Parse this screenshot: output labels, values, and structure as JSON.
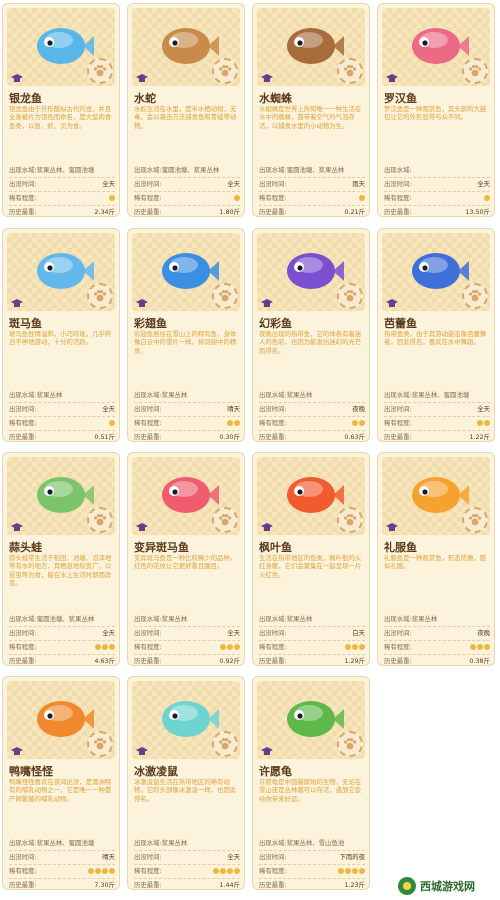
{
  "row_labels": {
    "water": "出现水域:",
    "time": "出没时间:",
    "rarity": "稀有程度:",
    "history": "历史最重:"
  },
  "watermark": {
    "text": "西城游戏网"
  },
  "cards": [
    {
      "id": "silver-arowana",
      "name": "银龙鱼",
      "desc": "银龙鱼由于外形酷似古代的龙，并且全身被片为银色而命名，是大型肉食鱼类，以鱼、虾、贝为食。",
      "water": "出现水域:浆果丛林、蜜圆池塘",
      "time": "全天",
      "rarity": 1,
      "history": "2.34斤",
      "color": "#58b7e8"
    },
    {
      "id": "water-snake",
      "name": "水蛇",
      "desc": "水蛇生活在水里，是半水栖动物，无毒，会以袭击方法捕食鱼和青蛙等动物。",
      "water": "出现水域:蜜圆池塘、浆果丛林",
      "time": "全天",
      "rarity": 1,
      "history": "1.80斤",
      "color": "#c98a4a"
    },
    {
      "id": "water-spider",
      "name": "水蜘蛛",
      "desc": "水蜘蛛是世界上所知唯一一种生活在水中的蜘蛛，靠带着空气的气泡存活，以捕食水里的小动物为生。",
      "water": "出现水域:蜜圆池塘、浆果丛林",
      "time": "雨天",
      "rarity": 1,
      "history": "0.21斤",
      "color": "#a86b3c"
    },
    {
      "id": "luohan-fish",
      "name": "罗汉鱼",
      "desc": "罗汉鱼是一种观赏鱼，其头部的大鼓包让它的外形显得与众不同。",
      "water": "出现水域:",
      "time": "全天",
      "rarity": 1,
      "history": "13.50斤",
      "color": "#ec6a86"
    },
    {
      "id": "zebra-seahorse",
      "name": "斑马鱼",
      "desc": "斑马鱼性情温和，小巧玲珑，几乎终日不停地游动，十分的活跃。",
      "water": "出现水域:浆果丛林",
      "time": "全天",
      "rarity": 1,
      "history": "0.51斤",
      "color": "#62b8ea"
    },
    {
      "id": "rainbow-wing",
      "name": "彩翅鱼",
      "desc": "彩翅鱼居住在雪山上的特有鱼，身体像白云中的雪片一样，将羽翅中的精灵。",
      "water": "出现水域:浆果丛林",
      "time": "晴天",
      "rarity": 2,
      "history": "0.30斤",
      "color": "#3b8fe0"
    },
    {
      "id": "fantasy-fish",
      "name": "幻彩鱼",
      "desc": "夜晚出现的热带鱼，它的体表有着迷人的色彩，也因为能发出迷幻的光芒而得名。",
      "water": "出现水域:浆果丛林",
      "time": "夜晚",
      "rarity": 2,
      "history": "0.63斤",
      "color": "#7a4fd0"
    },
    {
      "id": "ballet-fish",
      "name": "芭蕾鱼",
      "desc": "热带鱼类，由于其游动姿态像芭蕾舞者，因此得名。喜欢在水中舞蹈。",
      "water": "出现水域:浆果丛林、蜜圆池塘",
      "time": "全天",
      "rarity": 2,
      "history": "1.22斤",
      "color": "#3f6fd8"
    },
    {
      "id": "garlic-frog",
      "name": "蒜头蛙",
      "desc": "蒜头蛙常生活于稻田、池塘、沼泽地等有水的地方，其栖息地较宽广，以昆虫等为食，能在水上生活时期而改变。",
      "water": "出现水域:蜜圆池塘、浆果丛林",
      "time": "全天",
      "rarity": 3,
      "history": "4.63斤",
      "color": "#7cc46b"
    },
    {
      "id": "mutant-zebra",
      "name": "变异斑马鱼",
      "desc": "变异斑马鱼是一种比较稀少的品种，红色的花纹让它更好看且醒目。",
      "water": "出现水域:浆果丛林",
      "time": "全天",
      "rarity": 3,
      "history": "0.92斤",
      "color": "#ee5c6d"
    },
    {
      "id": "maple-fish",
      "name": "枫叶鱼",
      "desc": "生活在热带地区的鱼类，枫叶般的火红身躯，它们会聚集在一起呈现一片火红色。",
      "water": "出现水域:浆果丛林",
      "time": "白天",
      "rarity": 3,
      "history": "1.29斤",
      "color": "#f25a2f"
    },
    {
      "id": "gown-fish",
      "name": "礼服鱼",
      "desc": "礼服鱼是一种观赏鱼，形态优雅，酷似礼服。",
      "water": "出现水域:浆果丛林",
      "time": "夜晚",
      "rarity": 3,
      "history": "0.38斤",
      "color": "#f6a230"
    },
    {
      "id": "duckbill",
      "name": "鸭嘴怪怪",
      "desc": "鸭嘴怪怪喜欢在夜间出没，是澳洲特有的哺乳动物之一，它是唯一一种靠产卵繁殖的哺乳动物。",
      "water": "出现水域:浆果丛林、蜜圆池塘",
      "time": "晴天",
      "rarity": 4,
      "history": "7.30斤",
      "color": "#f0892d"
    },
    {
      "id": "ice-mouse",
      "name": "冰激凌鼠",
      "desc": "冰激凌鼠生活在热带地区的稀有动物，它的头部像冰激凌一样，也因此得名。",
      "water": "出现水域:浆果丛林",
      "time": "全天",
      "rarity": 4,
      "history": "1.44斤",
      "color": "#6fd3d0"
    },
    {
      "id": "wish-turtle",
      "name": "许愿龟",
      "desc": "许愿龟是中国最原始的生物，无论在雪山还是丛林都可以存活，遇到它会给你带来好运。",
      "water": "出现水域:浆果丛林、雪山鱼池",
      "time": "下雨的夜",
      "rarity": 4,
      "history": "1.23斤",
      "color": "#5fb84a"
    }
  ]
}
